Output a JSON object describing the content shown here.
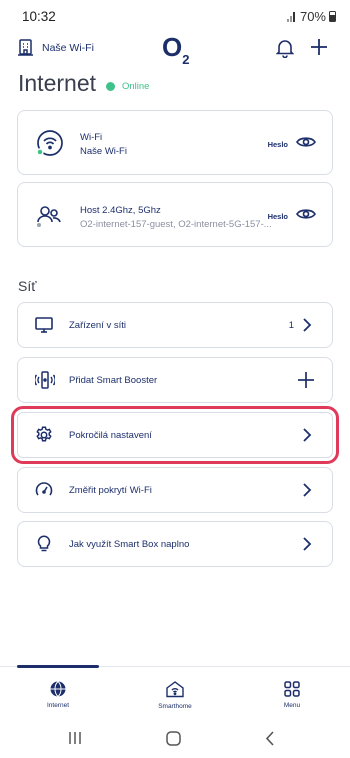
{
  "status": {
    "time": "10:32",
    "battery": "70%"
  },
  "header": {
    "network_name": "Naše Wi-Fi",
    "logo": "O",
    "logo_sub": "2"
  },
  "page": {
    "title": "Internet",
    "status": "Online",
    "status_color": "#3fc28a"
  },
  "wifi_card": {
    "label": "Wi-Fi",
    "name": "Naše Wi-Fi",
    "password_label": "Heslo"
  },
  "guest_card": {
    "label": "Host 2.4Ghz, 5Ghz",
    "names": "O2-internet-157-guest, O2-internet-5G-157-...",
    "password_label": "Heslo"
  },
  "section": {
    "title": "Síť"
  },
  "menu": [
    {
      "label": "Zařízení v síti",
      "count": "1",
      "icon": "monitor-icon"
    },
    {
      "label": "Přidat Smart Booster",
      "icon": "booster-icon"
    },
    {
      "label": "Pokročilá nastavení",
      "icon": "gear-icon"
    },
    {
      "label": "Změřit pokrytí Wi-Fi",
      "icon": "gauge-icon"
    },
    {
      "label": "Jak využít Smart Box naplno",
      "icon": "lightbulb-icon"
    }
  ],
  "bottom_nav": [
    {
      "label": "Internet",
      "icon": "globe-icon",
      "active": true
    },
    {
      "label": "Smarthome",
      "icon": "smarthome-icon",
      "active": false
    },
    {
      "label": "Menu",
      "icon": "grid-icon",
      "active": false
    }
  ],
  "colors": {
    "primary": "#1d2f6b",
    "highlight": "#e03a5a",
    "online": "#3fc28a"
  }
}
